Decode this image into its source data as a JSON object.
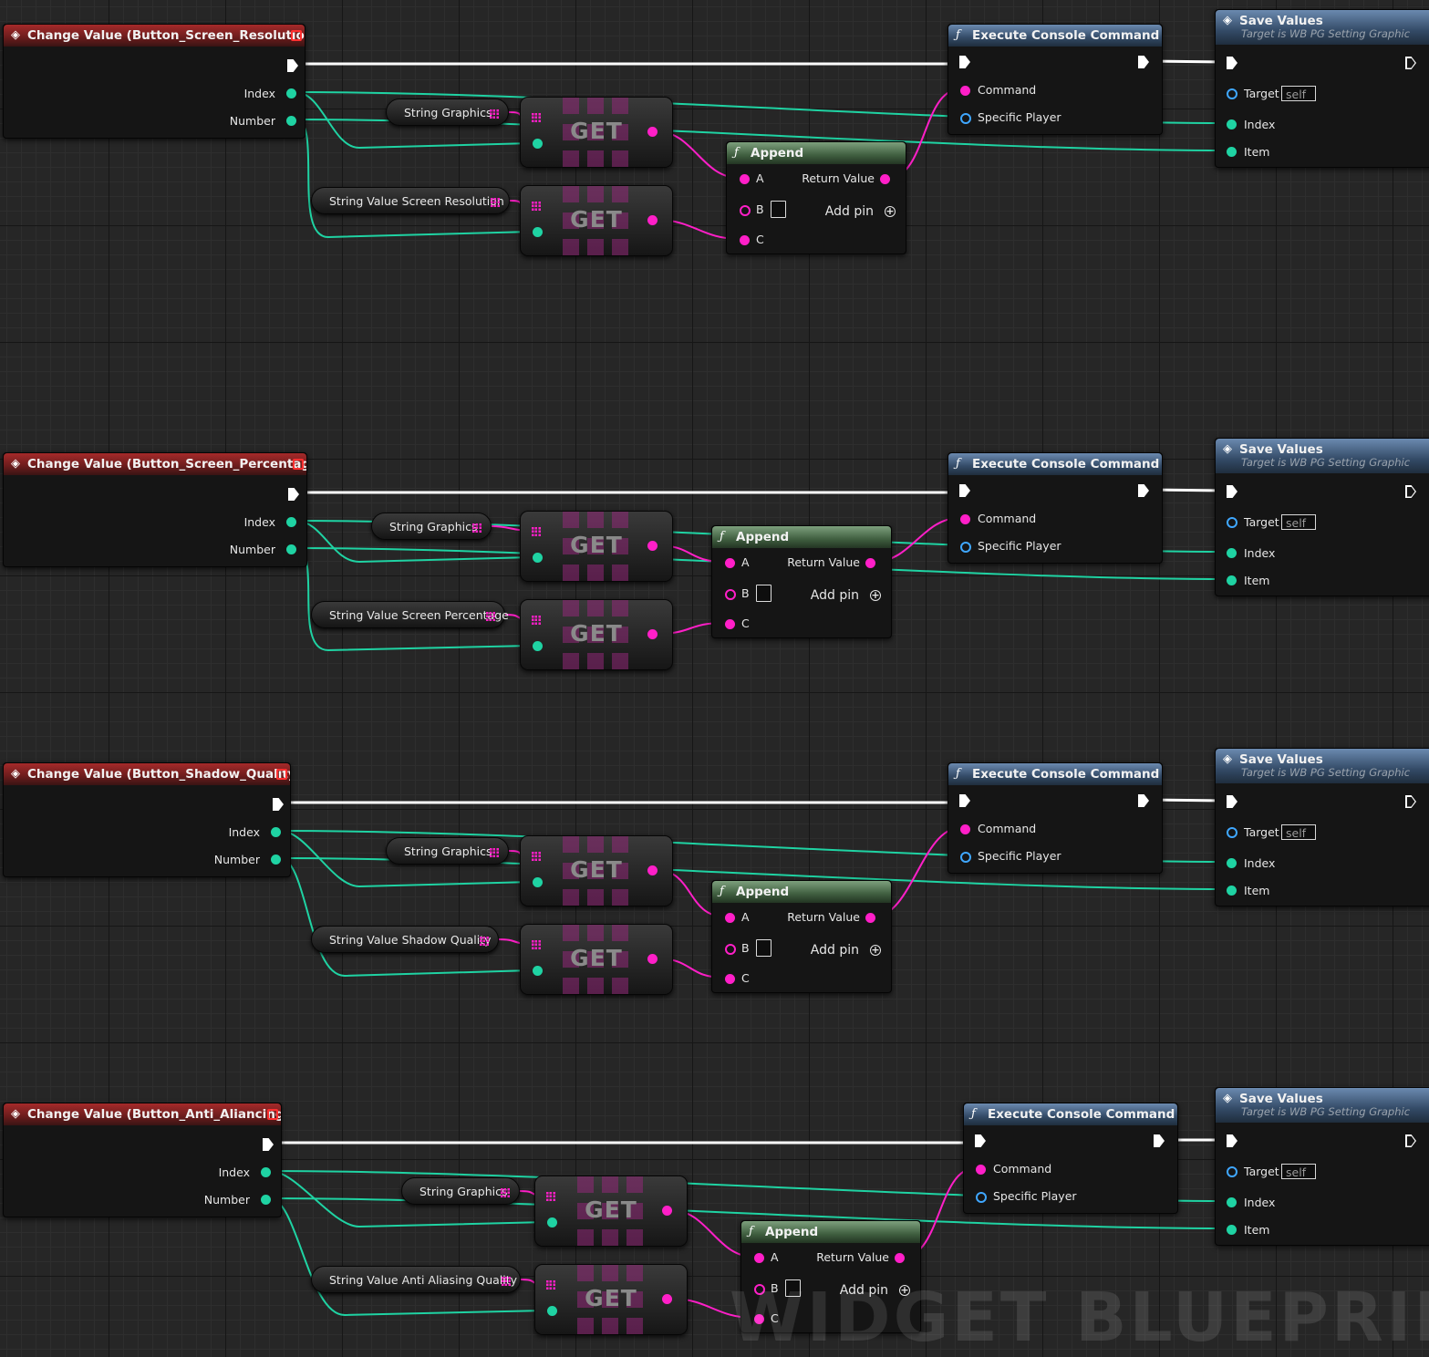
{
  "colors": {
    "exec_wire": "#ffffff",
    "int_pin": "#1fd3a3",
    "string_pin": "#ff1fc8",
    "object_pin": "#3fa7ff",
    "event_header": "#a52a2a",
    "function_header": "#334a66",
    "pure_header": "#3f5e3f"
  },
  "icons": {
    "event": "event-diamond-icon",
    "function": "function-f-icon",
    "array": "array-grid-icon",
    "add": "add-pin-plus-icon",
    "delegate": "delegate-square-icon"
  },
  "groups": [
    {
      "event": {
        "title": "Change Value (Button_Screen_Resolution)",
        "index": "Index",
        "number": "Number"
      },
      "var1": {
        "label": "String Graphics"
      },
      "var2": {
        "label": "String Value Screen Resolution"
      },
      "get_label": "GET",
      "append": {
        "title": "Append",
        "a": "A",
        "b": "B",
        "c": "C",
        "ret": "Return Value",
        "add": "Add pin"
      },
      "exec": {
        "title": "Execute Console Command",
        "command": "Command",
        "player": "Specific Player"
      },
      "save": {
        "title": "Save Values",
        "subtitle": "Target is WB PG Setting Graphic",
        "target": "Target",
        "self": "self",
        "index": "Index",
        "item": "Item"
      }
    },
    {
      "event": {
        "title": "Change Value (Button_Screen_Percentage)",
        "index": "Index",
        "number": "Number"
      },
      "var1": {
        "label": "String Graphics"
      },
      "var2": {
        "label": "String Value Screen Percentage"
      },
      "get_label": "GET",
      "append": {
        "title": "Append",
        "a": "A",
        "b": "B",
        "c": "C",
        "ret": "Return Value",
        "add": "Add pin"
      },
      "exec": {
        "title": "Execute Console Command",
        "command": "Command",
        "player": "Specific Player"
      },
      "save": {
        "title": "Save Values",
        "subtitle": "Target is WB PG Setting Graphic",
        "target": "Target",
        "self": "self",
        "index": "Index",
        "item": "Item"
      }
    },
    {
      "event": {
        "title": "Change Value (Button_Shadow_Quality)",
        "index": "Index",
        "number": "Number"
      },
      "var1": {
        "label": "String Graphics"
      },
      "var2": {
        "label": "String Value Shadow Quality"
      },
      "get_label": "GET",
      "append": {
        "title": "Append",
        "a": "A",
        "b": "B",
        "c": "C",
        "ret": "Return Value",
        "add": "Add pin"
      },
      "exec": {
        "title": "Execute Console Command",
        "command": "Command",
        "player": "Specific Player"
      },
      "save": {
        "title": "Save Values",
        "subtitle": "Target is WB PG Setting Graphic",
        "target": "Target",
        "self": "self",
        "index": "Index",
        "item": "Item"
      }
    },
    {
      "event": {
        "title": "Change Value (Button_Anti_Aliancing)",
        "index": "Index",
        "number": "Number"
      },
      "var1": {
        "label": "String Graphics"
      },
      "var2": {
        "label": "String Value Anti Aliasing Quality"
      },
      "get_label": "GET",
      "append": {
        "title": "Append",
        "a": "A",
        "b": "B",
        "c": "C",
        "ret": "Return Value",
        "add": "Add pin"
      },
      "exec": {
        "title": "Execute Console Command",
        "command": "Command",
        "player": "Specific Player"
      },
      "save": {
        "title": "Save Values",
        "subtitle": "Target is WB PG Setting Graphic",
        "target": "Target",
        "self": "self",
        "index": "Index",
        "item": "Item"
      }
    }
  ],
  "watermark": "WIDGET BLUEPRINT"
}
